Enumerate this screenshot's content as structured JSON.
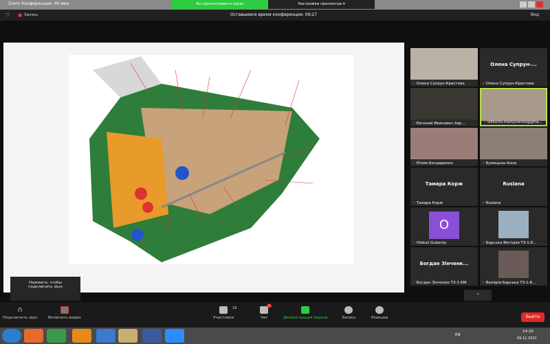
{
  "window": {
    "title": "Zoom Конференция. 40 мин",
    "share_banner": "Вы просматриваете экран viktoriia.martynenko@gmail.com",
    "view_options": "Настройки просмотра ▾"
  },
  "meeting_bar": {
    "recording": "Запись",
    "time_left": "Оставшееся время конференции: 09:27",
    "view": "Вид"
  },
  "tooltip": "Нажмите, чтобы подключить звук",
  "participants": [
    {
      "name": "Олена Супрун-Крастова",
      "video": true
    },
    {
      "name": "Олена Супрун-Крастова",
      "display": "Олена Супрун-...",
      "video": false
    },
    {
      "name": "Евгений Иванович Хар...",
      "video": true
    },
    {
      "name": "viktoriia.martynenko@gma...",
      "video": true,
      "active": true
    },
    {
      "name": "Юлия Бондаренко",
      "video": true
    },
    {
      "name": "Бумецька Анна",
      "video": true
    },
    {
      "name": "Тамара Корж",
      "display": "Тамара Корж",
      "video": false
    },
    {
      "name": "Ruslana",
      "display": "Ruslana",
      "video": false
    },
    {
      "name": "Oleksii Gubenia",
      "initial": "O",
      "video": false
    },
    {
      "name": "Барська Вікторія ТЗ-1-6...",
      "video": true
    },
    {
      "name": "Богдан Зінченко ТЗ-1-6М",
      "display": "Богдан Зінченк...",
      "video": false
    },
    {
      "name": "Валерія Барська ТЗ-1-6...",
      "video": true
    }
  ],
  "toolbar": {
    "audio": "Подключить звук",
    "video": "Включить видео",
    "participants": "Участники",
    "participants_count": "19",
    "chat": "Чат",
    "chat_badge": "1",
    "share": "Демонстрация экрана",
    "record": "Запись",
    "reactions": "Реакции",
    "leave": "Выйти"
  },
  "tray": {
    "lang": "EN",
    "time": "14:20",
    "date": "09.11.2021"
  },
  "colors": {
    "accent_green": "#2ecc40",
    "leave_red": "#e02828",
    "avatar_purple": "#8a4fd8"
  }
}
